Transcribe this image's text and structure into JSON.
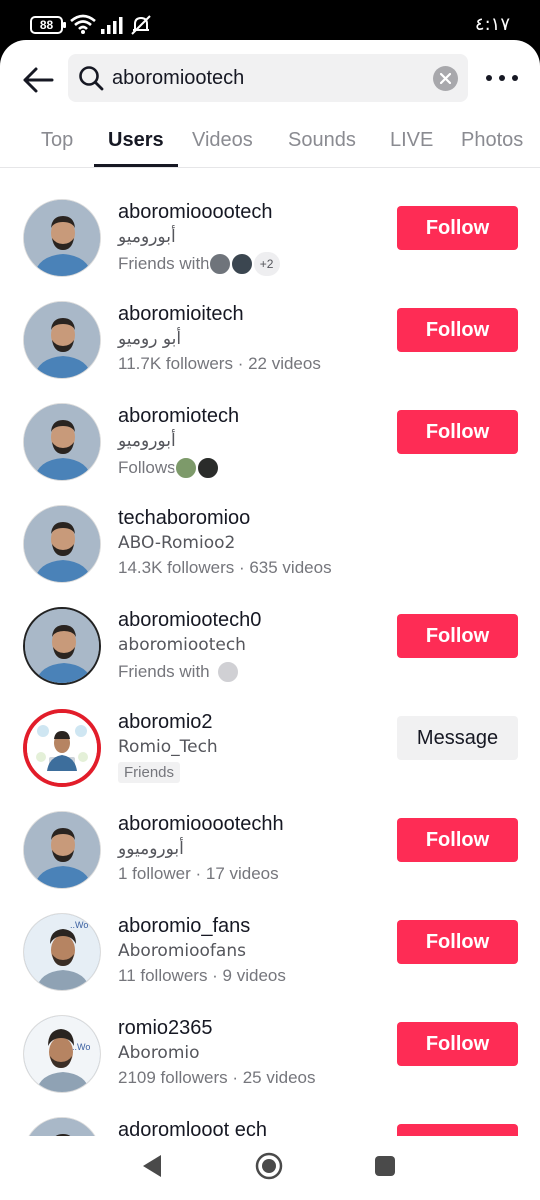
{
  "status_bar": {
    "battery": "88",
    "time": "٤:١٧",
    "icons": [
      "wifi-icon",
      "signal-icon",
      "mute-icon"
    ]
  },
  "search": {
    "query": "aboromiootech",
    "icons": [
      "back-arrow-icon",
      "search-icon",
      "clear-icon",
      "more-icon"
    ]
  },
  "tabs": [
    {
      "label": "Top"
    },
    {
      "label": "Users",
      "active": true
    },
    {
      "label": "Videos"
    },
    {
      "label": "Sounds"
    },
    {
      "label": "LIVE"
    },
    {
      "label": "Photos"
    }
  ],
  "results": [
    {
      "username": "aboromiooootech",
      "nickname": "أبوروميو",
      "meta": "Friends with",
      "meta_extra": "+2",
      "action": "Follow"
    },
    {
      "username": "aboromioitech",
      "nickname": "أبو روميو",
      "meta": "11.7K followers · 22 videos",
      "action": "Follow"
    },
    {
      "username": "aboromiotech",
      "nickname": "أبوروميو",
      "meta": "Follows",
      "action": "Follow"
    },
    {
      "username": "techaboromioo",
      "nickname": "ABO-Romioo2",
      "meta": "14.3K followers · 635 videos",
      "action": ""
    },
    {
      "username": "aboromiootech0",
      "nickname": "aboromiootech",
      "meta": "Friends with",
      "action": "Follow"
    },
    {
      "username": "aboromio2",
      "nickname": "Romio_Tech",
      "meta": "Friends",
      "action": "Message"
    },
    {
      "username": "aboromiooootechh",
      "nickname": "أبوروميوو",
      "meta": "1 follower · 17 videos",
      "action": "Follow"
    },
    {
      "username": "aboromio_fans",
      "nickname": "Aboromioofans",
      "meta": "11 followers · 9 videos",
      "action": "Follow"
    },
    {
      "username": "romio2365",
      "nickname": "Aboromio",
      "meta": "2109 followers · 25 videos",
      "action": "Follow"
    },
    {
      "username": "adoromlooot ech",
      "nickname": "",
      "meta": "",
      "action": "Follow"
    }
  ],
  "colors": {
    "accent": "#fe2c55",
    "text": "#161823",
    "muted": "#75767c",
    "chip": "#f1f1f2"
  },
  "nav": {
    "icons": [
      "nav-back-icon",
      "nav-home-icon",
      "nav-recents-icon"
    ]
  }
}
